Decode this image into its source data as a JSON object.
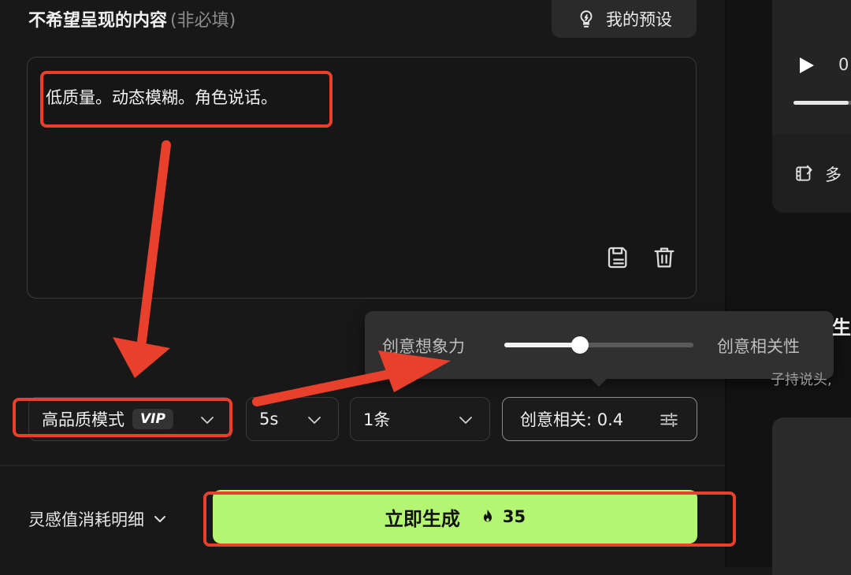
{
  "negative_prompt": {
    "title": "不希望呈现的内容",
    "optional_hint": "(非必填)",
    "text": "低质量。动态模糊。角色说话。"
  },
  "preset_button": {
    "label": "我的预设",
    "icon": "lightbulb-icon"
  },
  "textarea_actions": {
    "save_icon": "save-icon",
    "delete_icon": "trash-icon"
  },
  "creativity_popover": {
    "left_label": "创意想象力",
    "right_label": "创意相关性",
    "value": 0.4
  },
  "settings": {
    "quality_label": "高品质模式",
    "vip_badge": "VIP",
    "duration": "5s",
    "count": "1条",
    "creative_label": "创意相关: 0.4"
  },
  "footer": {
    "credit_detail_label": "灵感值消耗明细",
    "generate_label": "立即生成",
    "generate_cost": "35"
  },
  "right_panel": {
    "time_partial": "0",
    "multi_label_partial": "多",
    "heading_partial": "生",
    "desc_partial": "子持说头,"
  },
  "colors": {
    "background": "#181818",
    "generate_button": "#b4f571",
    "annotation_red": "#e9402b"
  }
}
